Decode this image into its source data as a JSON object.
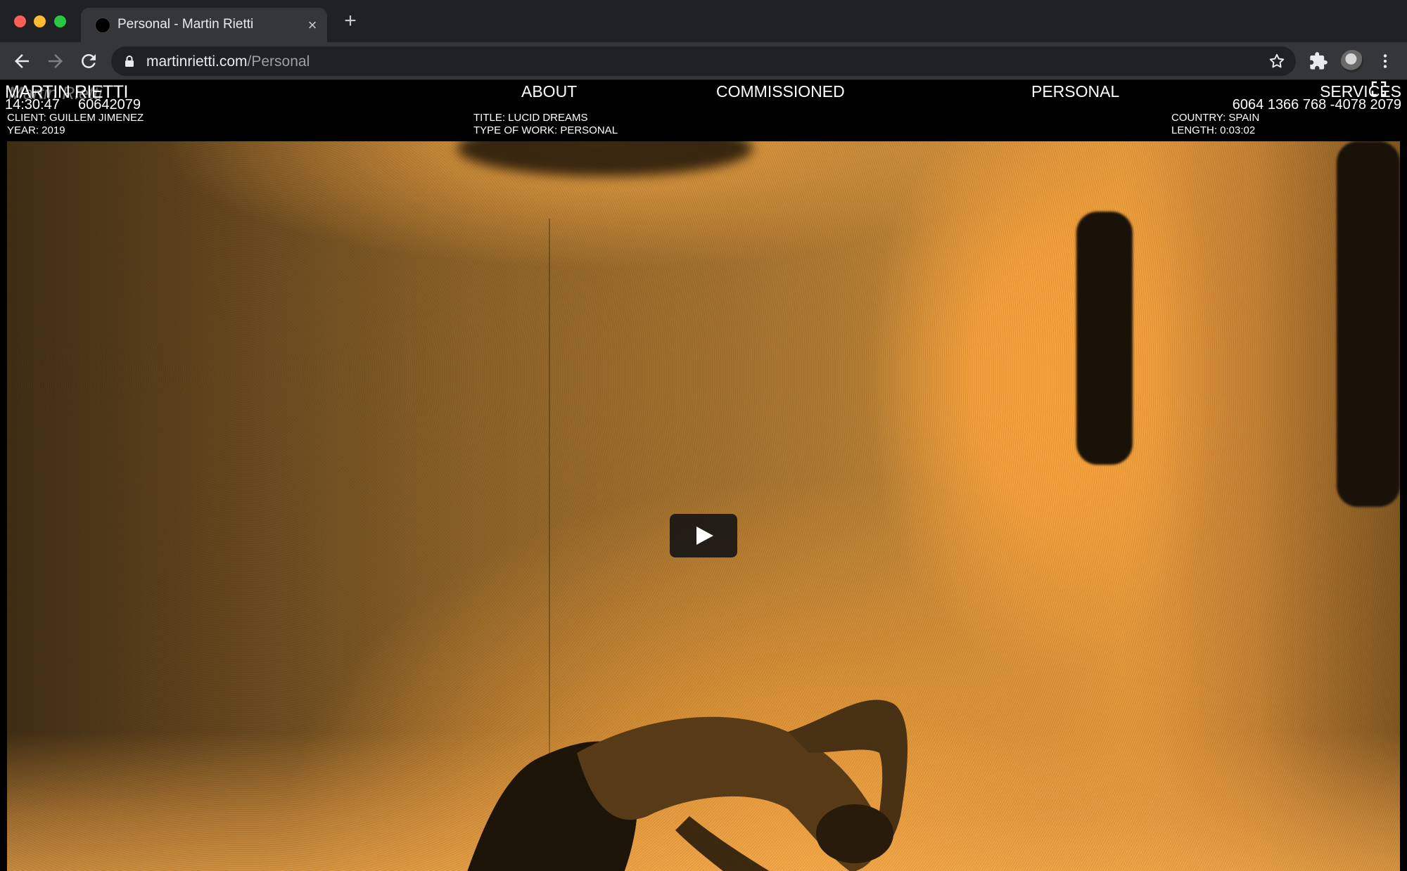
{
  "browser": {
    "tab": {
      "title": "Personal - Martin Rietti"
    },
    "address_bar": {
      "host": "martinrietti.com",
      "path": "/Personal"
    }
  },
  "site": {
    "logo": "MARTIN RIETTI",
    "nav": {
      "about": "ABOUT",
      "commissioned": "COMMISSIONED",
      "personal": "PERSONAL",
      "services": "SERVICES"
    },
    "clock": "14:30:47",
    "counter_left": "60642079",
    "counter_right": "6064 1366 768 -4078 2079"
  },
  "project": {
    "client": "CLIENT: GUILLEM JIMENEZ",
    "year": "YEAR: 2019",
    "title": "TITLE: LUCID DREAMS",
    "type_of_work": "TYPE OF WORK: PERSONAL",
    "country": "COUNTRY: SPAIN",
    "length": "LENGTH: 0:03:02"
  },
  "colors": {
    "accent": "#f9a33c",
    "chrome_dark": "#202124",
    "chrome_toolbar": "#35363a"
  }
}
